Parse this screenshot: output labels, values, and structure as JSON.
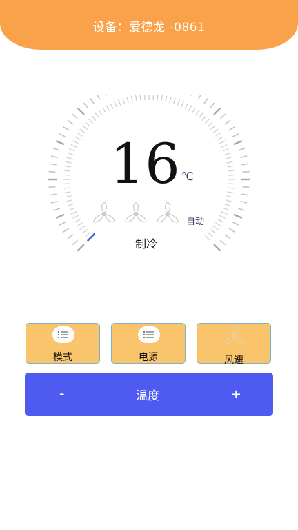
{
  "header": {
    "title": "设备：爱德龙 -0861"
  },
  "thermostat": {
    "temperature": "16",
    "unit": "℃",
    "fan_mode": "自动",
    "mode": "制冷",
    "fan_levels": 3,
    "setpoint_fraction": 0.0
  },
  "controls": [
    {
      "label": "模式",
      "icon": "list-icon"
    },
    {
      "label": "电源",
      "icon": "list-icon"
    },
    {
      "label": "风速",
      "icon": "fan-icon"
    }
  ],
  "temp_bar": {
    "label": "温度",
    "minus": "-",
    "plus": "+"
  },
  "colors": {
    "header": "#f9a24a",
    "button_bg": "#f9c46b",
    "button_border": "#7ab3c8",
    "bar_bg": "#4f5bf0",
    "indicator": "#3b64e0"
  }
}
